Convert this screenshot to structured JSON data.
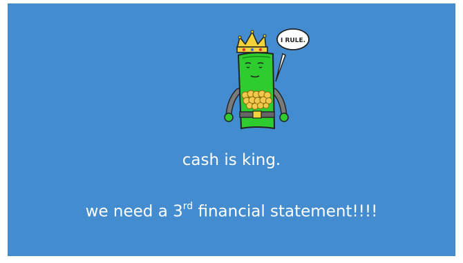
{
  "slide": {
    "background_color": "#438ccf",
    "speech_bubble_text": "I RULE.",
    "caption_line_1": "cash is king.",
    "caption_line_2_prefix": "we need a 3",
    "caption_line_2_superscript": "rd",
    "caption_line_2_suffix": " financial statement!!!!",
    "illustration_icon": "money-king-icon"
  }
}
